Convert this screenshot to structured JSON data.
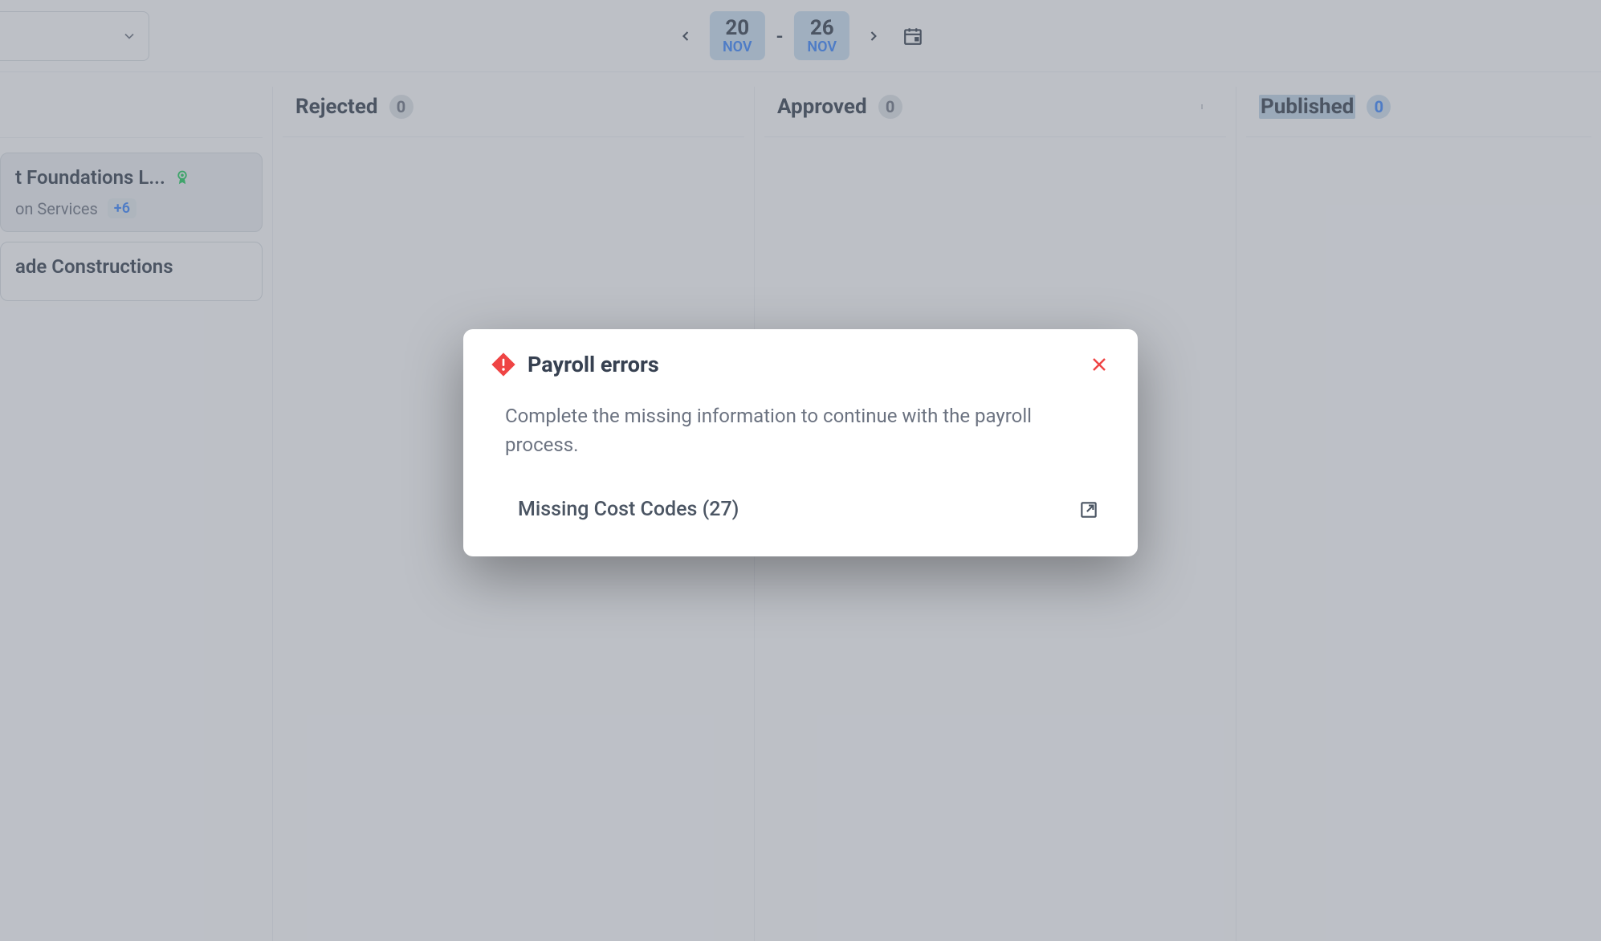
{
  "header": {
    "date_range": {
      "start_day": "20",
      "start_month": "NOV",
      "separator": "-",
      "end_day": "26",
      "end_month": "NOV"
    }
  },
  "columns": {
    "rejected": {
      "title": "Rejected",
      "count": "0"
    },
    "approved": {
      "title": "Approved",
      "count": "0"
    },
    "published": {
      "title": "Published",
      "count": "0"
    }
  },
  "cards": [
    {
      "title": "t Foundations L...",
      "subtitle": "on Services",
      "plus_tag": "+6",
      "certified": true
    },
    {
      "title": "ade Constructions",
      "subtitle": "",
      "plus_tag": "",
      "certified": false
    }
  ],
  "modal": {
    "title": "Payroll errors",
    "description": "Complete the missing information to continue with the payroll process.",
    "errors": [
      {
        "label": "Missing Cost Codes (27)"
      }
    ]
  }
}
